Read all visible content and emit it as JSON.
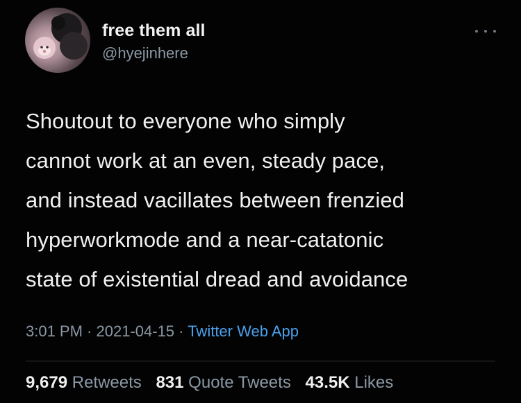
{
  "tweet": {
    "author": {
      "display_name": "free them all",
      "handle": "@hyejinhere"
    },
    "more_icon": "more-horizontal-icon",
    "text_lines": [
      "Shoutout to everyone who simply",
      "cannot work at an even, steady pace,",
      "and instead vacillates between frenzied",
      "hyperworkmode and a near-catatonic",
      "state of existential dread and avoidance"
    ],
    "time": "3:01 PM",
    "separator": " · ",
    "date": "2021-04-15",
    "source": "Twitter Web App",
    "stats": {
      "retweets_count": "9,679",
      "retweets_label": "Retweets",
      "quote_tweets_count": "831",
      "quote_tweets_label": "Quote Tweets",
      "likes_count": "43.5K",
      "likes_label": "Likes"
    },
    "colors": {
      "background": "#030303",
      "secondary_text": "#8b98a5",
      "link": "#4aa0ec"
    }
  }
}
